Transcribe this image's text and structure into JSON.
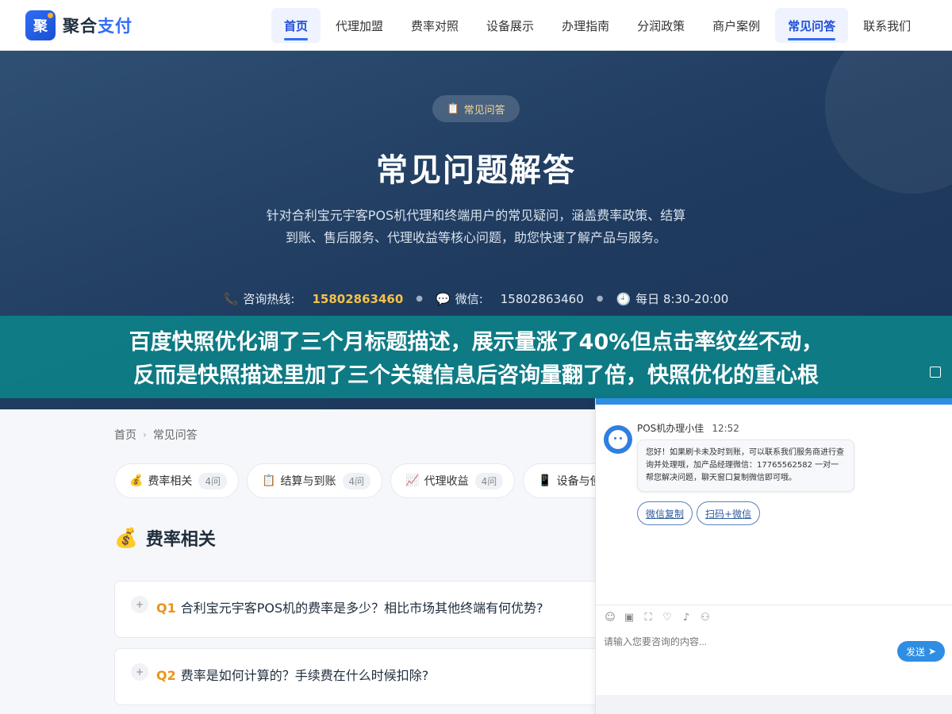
{
  "logo": {
    "mark": "聚",
    "name_main": "聚合",
    "name_accent": "支付"
  },
  "nav": {
    "items": [
      {
        "label": "首页",
        "active": true
      },
      {
        "label": "代理加盟"
      },
      {
        "label": "费率对照"
      },
      {
        "label": "设备展示"
      },
      {
        "label": "办理指南"
      },
      {
        "label": "分润政策"
      },
      {
        "label": "商户案例"
      },
      {
        "label": "常见问答",
        "active": true
      },
      {
        "label": "联系我们"
      }
    ]
  },
  "hero": {
    "badge": "常见问答",
    "title": "常见问题解答",
    "desc": "针对合利宝元宇客POS机代理和终端用户的常见疑问，涵盖费率政策、结算到账、售后服务、代理收益等核心问题，助您快速了解产品与服务。",
    "hotline_label": "咨询热线:",
    "hotline": "15802863460",
    "wechat_label": "微信:",
    "wechat": "15802863460",
    "hours": "每日 8:30-20:00"
  },
  "banner": {
    "line1": "百度快照优化调了三个月标题描述，展示量涨了40%但点击率纹丝不动，",
    "line2": "反而是快照描述里加了三个关键信息后咨询量翻了倍，快照优化的重心根"
  },
  "breadcrumb": {
    "home": "首页",
    "current": "常见问答"
  },
  "categories": [
    {
      "icon": "💰",
      "label": "费率相关",
      "count": "4问"
    },
    {
      "icon": "📋",
      "label": "结算与到账",
      "count": "4问"
    },
    {
      "icon": "📈",
      "label": "代理收益",
      "count": "4问"
    },
    {
      "icon": "📱",
      "label": "设备与使",
      "count": ""
    }
  ],
  "section": {
    "icon": "💰",
    "title": "费率相关"
  },
  "faqs": [
    {
      "num": "Q1",
      "question": "合利宝元宇客POS机的费率是多少？相比市场其他终端有何优势?"
    },
    {
      "num": "Q2",
      "question": "费率是如何计算的？手续费在什么时候扣除?"
    }
  ],
  "chat": {
    "agent_name": "POS机办理小佳",
    "time": "12:52",
    "message": "您好！如果刷卡未及时到账，可以联系我们服务商进行查询并处理哦，加产品经理微信：17765562582 一对一帮您解决问题，聊天窗口复制微信即可哦。",
    "btn_copy": "微信复制",
    "btn_scan": "扫码+微信",
    "placeholder": "请输入您要咨询的内容...",
    "send": "发送"
  }
}
